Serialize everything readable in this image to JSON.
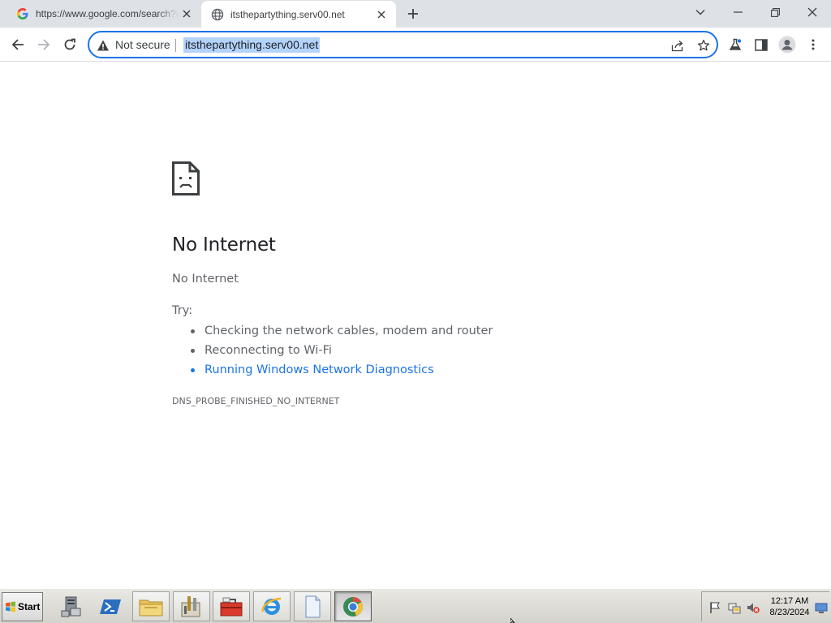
{
  "browser": {
    "tabs": [
      {
        "title": "https://www.google.com/search?q",
        "favicon": "google-g-icon",
        "active": false
      },
      {
        "title": "itsthepartything.serv00.net",
        "favicon": "globe-icon",
        "active": true
      }
    ],
    "address_bar": {
      "security_label": "Not secure",
      "url": "itsthepartything.serv00.net"
    },
    "accent_color": "#1a73e8"
  },
  "error_page": {
    "icon": "sad-page-icon",
    "heading": "No Internet",
    "subtext": "No Internet",
    "try_label": "Try:",
    "suggestions": [
      {
        "text": "Checking the network cables, modem and router",
        "is_link": false
      },
      {
        "text": "Reconnecting to Wi-Fi",
        "is_link": false
      },
      {
        "text": "Running Windows Network Diagnostics",
        "is_link": true
      }
    ],
    "error_code": "DNS_PROBE_FINISHED_NO_INTERNET"
  },
  "taskbar": {
    "start_label": "Start",
    "pinned": [
      "server-manager-icon",
      "powershell-icon",
      "file-explorer-icon",
      "admin-tools-icon",
      "toolbox-icon",
      "internet-explorer-icon",
      "notepad-icon",
      "chrome-icon"
    ],
    "tray_icons": [
      "action-center-flag-icon",
      "network-icon",
      "volume-muted-icon",
      "show-desktop-icon"
    ],
    "clock": {
      "time": "12:17 AM",
      "date": "8/23/2024"
    }
  }
}
